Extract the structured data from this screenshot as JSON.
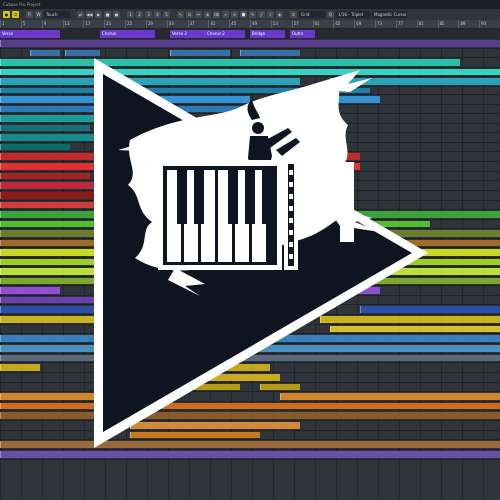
{
  "window": {
    "title": "Cubase Pro Project"
  },
  "toolbar": {
    "buttons": [
      {
        "name": "activate-project-button",
        "label": "●",
        "kind": "yellow"
      },
      {
        "name": "constrain-delay-button",
        "label": "⏻",
        "kind": "yellow"
      },
      {
        "name": "read-automation-button",
        "label": "R",
        "kind": "normal"
      },
      {
        "name": "write-automation-button",
        "label": "W",
        "kind": "normal"
      },
      {
        "name": "automation-mode-field",
        "label": "Touch",
        "kind": "field"
      },
      {
        "name": "autoscroll-button",
        "label": "⇄",
        "kind": "normal"
      },
      {
        "name": "rewind-button",
        "label": "◀◀",
        "kind": "normal"
      },
      {
        "name": "play-button",
        "label": "▶",
        "kind": "normal"
      },
      {
        "name": "stop-button",
        "label": "■",
        "kind": "normal"
      },
      {
        "name": "record-button",
        "label": "●",
        "kind": "normal"
      },
      {
        "name": "counter-1",
        "label": "1",
        "kind": "normal"
      },
      {
        "name": "counter-2",
        "label": "2",
        "kind": "normal"
      },
      {
        "name": "counter-3",
        "label": "3",
        "kind": "normal"
      },
      {
        "name": "counter-4",
        "label": "4",
        "kind": "normal"
      },
      {
        "name": "counter-5",
        "label": "5",
        "kind": "normal"
      },
      {
        "name": "object-select-tool",
        "label": "↖",
        "kind": "normal"
      },
      {
        "name": "range-tool",
        "label": "⊡",
        "kind": "normal"
      },
      {
        "name": "split-tool",
        "label": "✂",
        "kind": "normal"
      },
      {
        "name": "glue-tool",
        "label": "⊕",
        "kind": "normal"
      },
      {
        "name": "erase-tool",
        "label": "⌫",
        "kind": "normal"
      },
      {
        "name": "zoom-tool",
        "label": "⌕",
        "kind": "normal"
      },
      {
        "name": "mute-tool",
        "label": "✕",
        "kind": "normal"
      },
      {
        "name": "time-warp-tool",
        "label": "⌚",
        "kind": "normal"
      },
      {
        "name": "draw-tool",
        "label": "✎",
        "kind": "normal"
      },
      {
        "name": "line-tool",
        "label": "╱",
        "kind": "normal"
      },
      {
        "name": "play-tool",
        "label": "♪",
        "kind": "normal"
      },
      {
        "name": "color-tool",
        "label": "◈",
        "kind": "normal"
      },
      {
        "name": "snap-button",
        "label": "⌗",
        "kind": "normal"
      },
      {
        "name": "grid-type-field",
        "label": "Grid",
        "kind": "field"
      },
      {
        "name": "quantize-button",
        "label": "Q",
        "kind": "normal"
      },
      {
        "name": "quantize-preset-field",
        "label": "1/16 - Triplet",
        "kind": "field"
      },
      {
        "name": "snap-type-field",
        "label": "Magnetic Cursor",
        "kind": "field"
      }
    ]
  },
  "ruler": {
    "bars": [
      "1",
      "5",
      "9",
      "13",
      "17",
      "21",
      "25",
      "29",
      "33",
      "37",
      "41",
      "45",
      "49",
      "53",
      "57",
      "61",
      "65",
      "69",
      "73",
      "77",
      "81",
      "85",
      "89",
      "93"
    ]
  },
  "markers": {
    "regions": [
      "Verse",
      "Chorus",
      "Verse 2",
      "Chorus 2",
      "Bridge",
      "Outro"
    ]
  },
  "colors": {
    "marker": "#6a39c9",
    "accent": "#d8c21a",
    "logo_fill": "#0e1520",
    "logo_outline": "#ffffff"
  },
  "logo": {
    "icon": "play-triangle-with-violinist-and-piano-keys-icon"
  }
}
